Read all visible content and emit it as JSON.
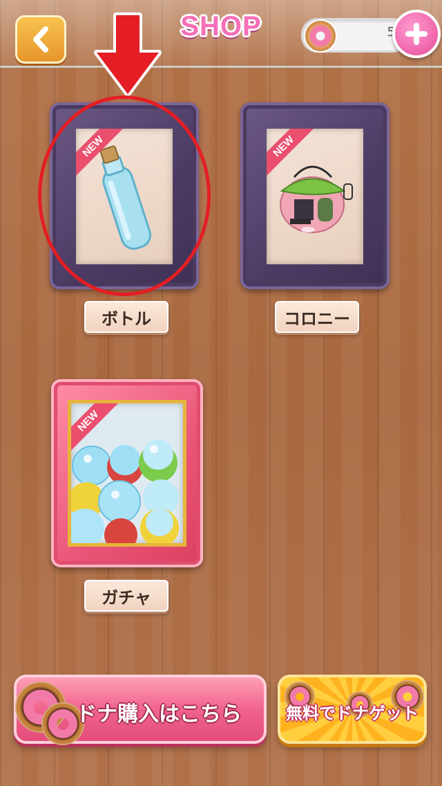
{
  "header": {
    "title": "SHOP",
    "back_icon": "chevron-left-icon",
    "currency_icon": "donut-icon",
    "currency_value": "5",
    "add_icon": "plus-icon"
  },
  "shop_items": [
    {
      "name": "ボトル",
      "badge": "NEW",
      "image": "bottle"
    },
    {
      "name": "コロニー",
      "badge": "NEW",
      "image": "colony-house"
    },
    {
      "name": "ガチャ",
      "badge": "NEW",
      "image": "gacha-capsules"
    }
  ],
  "banners": {
    "buy": "ドナ購入はこちら",
    "free": "無料でドナゲット"
  },
  "colors": {
    "accent_pink": "#f56fb7",
    "highlight_red": "#e41e24",
    "frame_purple": "#4b3b63",
    "frame_pink": "#ea5577"
  }
}
